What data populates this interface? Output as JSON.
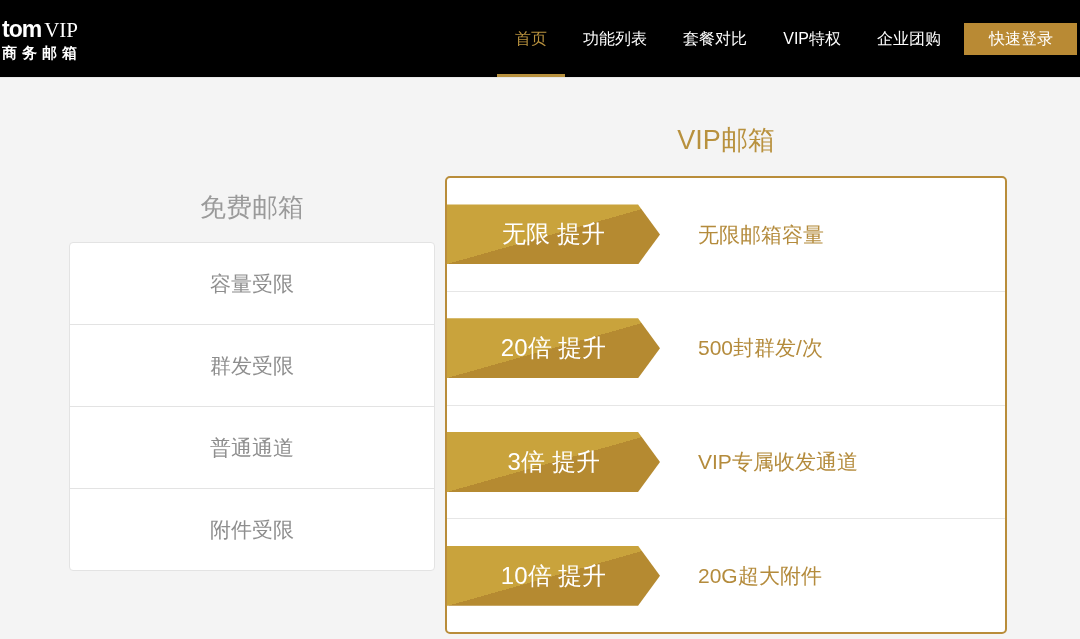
{
  "header": {
    "logo": {
      "wordmark": "tom",
      "badge": "VIP",
      "subtitle": "商务邮箱"
    },
    "nav": [
      {
        "label": "首页",
        "selected": true
      },
      {
        "label": "功能列表",
        "selected": false
      },
      {
        "label": "套餐对比",
        "selected": false
      },
      {
        "label": "VIP特权",
        "selected": false
      },
      {
        "label": "企业团购",
        "selected": false
      }
    ],
    "login_button": "快速登录"
  },
  "free_plan": {
    "title": "免费邮箱",
    "features": [
      "容量受限",
      "群发受限",
      "普通通道",
      "附件受限"
    ]
  },
  "vip_plan": {
    "title": "VIP邮箱",
    "features": [
      {
        "badge": "无限 提升",
        "description": "无限邮箱容量"
      },
      {
        "badge": "20倍 提升",
        "description": "500封群发/次"
      },
      {
        "badge": "3倍 提升",
        "description": "VIP专属收发通道"
      },
      {
        "badge": "10倍 提升",
        "description": "20G超大附件"
      }
    ]
  }
}
